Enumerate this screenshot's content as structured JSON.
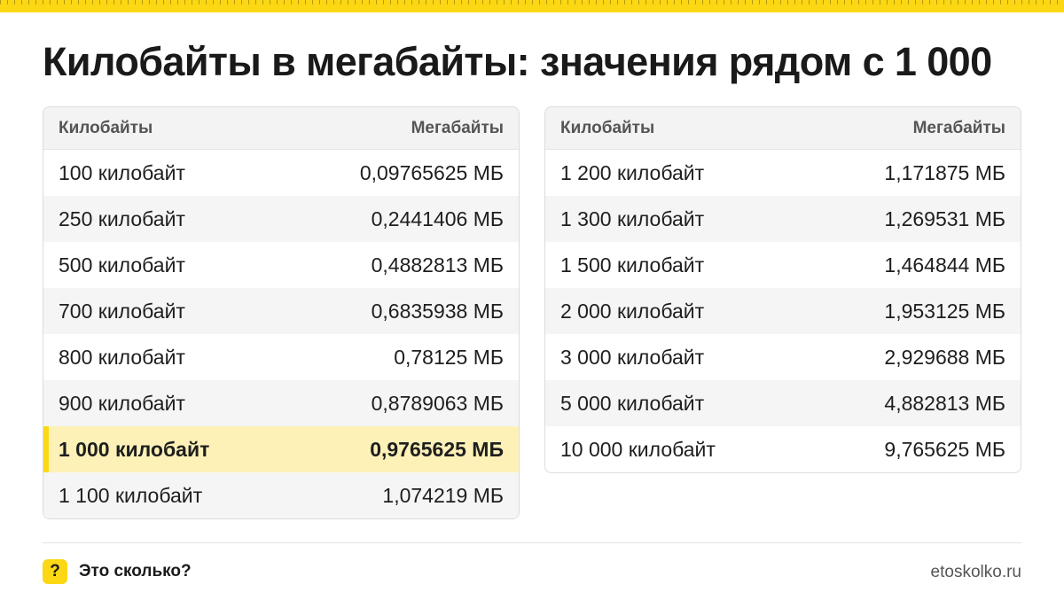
{
  "title": "Килобайты в мегабайты: значения рядом с 1 000",
  "left_table": {
    "headers": [
      "Килобайты",
      "Мегабайты"
    ],
    "rows": [
      [
        "100 килобайт",
        "0,09765625 МБ"
      ],
      [
        "250 килобайт",
        "0,2441406 МБ"
      ],
      [
        "500 килобайт",
        "0,4882813 МБ"
      ],
      [
        "700 килобайт",
        "0,6835938 МБ"
      ],
      [
        "800 килобайт",
        "0,78125 МБ"
      ],
      [
        "900 килобайт",
        "0,8789063 МБ"
      ],
      [
        "1 000 килобайт",
        "0,9765625 МБ"
      ],
      [
        "1 100 килобайт",
        "1,074219 МБ"
      ]
    ],
    "highlighted_row": 6
  },
  "right_table": {
    "headers": [
      "Килобайты",
      "Мегабайты"
    ],
    "rows": [
      [
        "1 200 килобайт",
        "1,171875 МБ"
      ],
      [
        "1 300 килобайт",
        "1,269531 МБ"
      ],
      [
        "1 500 килобайт",
        "1,464844 МБ"
      ],
      [
        "2 000 килобайт",
        "1,953125 МБ"
      ],
      [
        "3 000 килобайт",
        "2,929688 МБ"
      ],
      [
        "5 000 килобайт",
        "4,882813 МБ"
      ],
      [
        "10 000 килобайт",
        "9,765625 МБ"
      ]
    ]
  },
  "footer": {
    "badge": "?",
    "brand": "Это сколько?",
    "site": "etoskolko.ru"
  },
  "colors": {
    "accent": "#fbd714",
    "highlight_row": "#fdf1b8"
  }
}
